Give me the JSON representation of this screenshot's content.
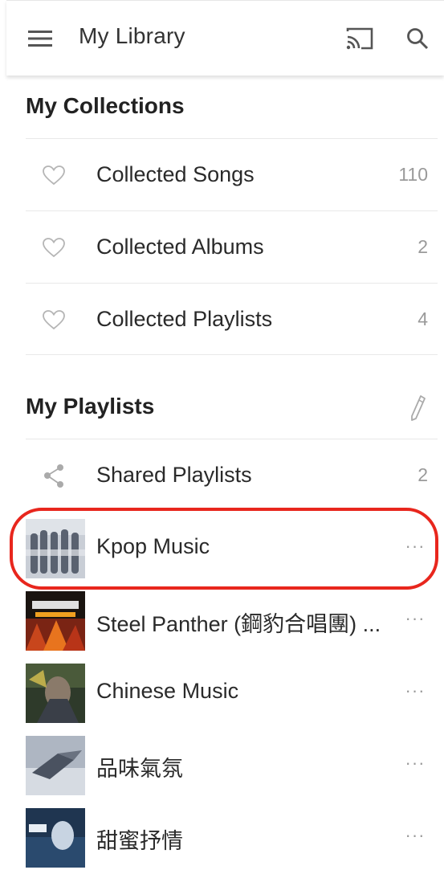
{
  "appbar": {
    "title": "My Library",
    "menu_icon": "hamburger-menu-icon",
    "cast_icon": "cast-icon",
    "search_icon": "search-icon"
  },
  "collections": {
    "title": "My Collections",
    "items": [
      {
        "label": "Collected Songs",
        "count": "110",
        "icon": "heart-outline-icon"
      },
      {
        "label": "Collected Albums",
        "count": "2",
        "icon": "heart-outline-icon"
      },
      {
        "label": "Collected Playlists",
        "count": "4",
        "icon": "heart-outline-icon"
      }
    ]
  },
  "playlists": {
    "title": "My Playlists",
    "edit_icon": "pencil-icon",
    "shared": {
      "label": "Shared Playlists",
      "count": "2",
      "icon": "share-icon"
    },
    "items": [
      {
        "label": "Kpop Music",
        "more": "···",
        "highlighted": true
      },
      {
        "label": "Steel Panther (鋼豹合唱團) ...",
        "more": "···",
        "thumb_text": "STEEL"
      },
      {
        "label": "Chinese Music",
        "more": "···"
      },
      {
        "label": "品味氣氛",
        "more": "···"
      },
      {
        "label": "甜蜜抒情",
        "more": "···"
      }
    ]
  },
  "colors": {
    "highlight_ring": "#e8261d",
    "divider": "#e8e8e8",
    "count_text": "#9a9a9a"
  }
}
